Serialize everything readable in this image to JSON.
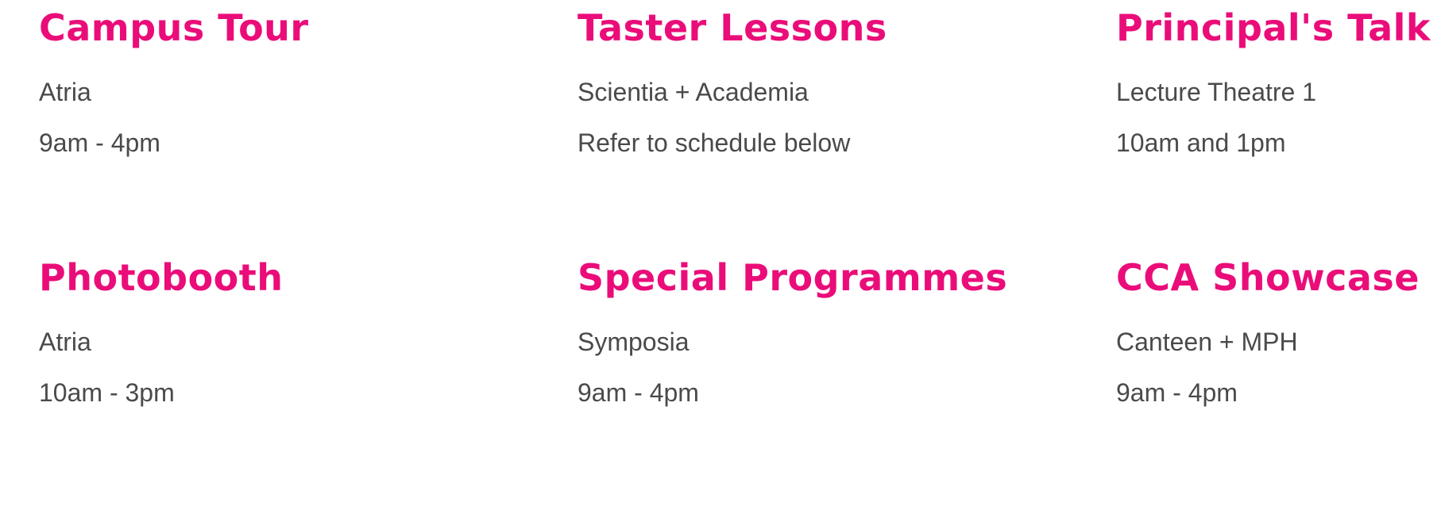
{
  "colors": {
    "title": "#ea0d79",
    "text": "#4a4a4a",
    "background": "#ffffff"
  },
  "events": [
    {
      "title": "Campus Tour",
      "location": "Atria",
      "time": "9am - 4pm"
    },
    {
      "title": "Taster Lessons",
      "location": "Scientia + Academia",
      "time": "Refer to schedule below"
    },
    {
      "title": "Principal's Talk",
      "location": "Lecture Theatre 1",
      "time": "10am and 1pm"
    },
    {
      "title": "Photobooth",
      "location": "Atria",
      "time": "10am - 3pm"
    },
    {
      "title": "Special Programmes",
      "location": "Symposia",
      "time": "9am - 4pm"
    },
    {
      "title": "CCA Showcase",
      "location": "Canteen + MPH",
      "time": "9am - 4pm"
    }
  ]
}
